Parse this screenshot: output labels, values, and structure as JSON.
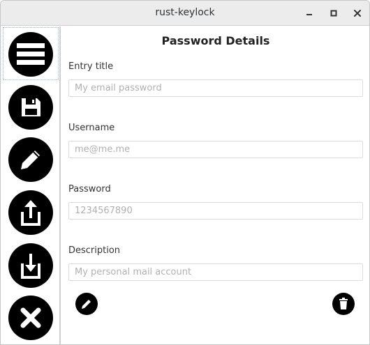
{
  "window": {
    "title": "rust-keylock"
  },
  "sidebar": {
    "items": [
      {
        "icon": "menu-icon"
      },
      {
        "icon": "save-icon"
      },
      {
        "icon": "edit-icon"
      },
      {
        "icon": "export-icon"
      },
      {
        "icon": "import-icon"
      },
      {
        "icon": "close-icon"
      }
    ]
  },
  "main": {
    "heading": "Password Details",
    "fields": {
      "title": {
        "label": "Entry title",
        "placeholder": "My email password",
        "value": ""
      },
      "username": {
        "label": "Username",
        "placeholder": "me@me.me",
        "value": ""
      },
      "password": {
        "label": "Password",
        "placeholder": "1234567890",
        "value": ""
      },
      "description": {
        "label": "Description",
        "placeholder": "My personal mail account",
        "value": ""
      }
    },
    "actions": [
      {
        "icon": "pencil-icon"
      },
      {
        "icon": "trash-icon"
      }
    ]
  },
  "colors": {
    "icon": "#000000",
    "icon_glyph": "#ffffff",
    "border": "#dcdcdc"
  }
}
